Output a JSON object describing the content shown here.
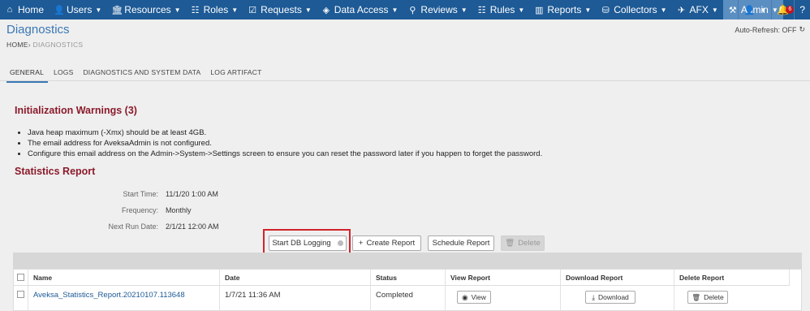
{
  "nav": {
    "items": [
      {
        "label": "Home",
        "icon": "home-icon",
        "glyph": "⌂",
        "caret": false
      },
      {
        "label": "Users",
        "icon": "users-icon",
        "glyph": "👤",
        "caret": true
      },
      {
        "label": "Resources",
        "icon": "building-icon",
        "glyph": "🏛",
        "caret": true
      },
      {
        "label": "Roles",
        "icon": "roles-icon",
        "glyph": "☷",
        "caret": true
      },
      {
        "label": "Requests",
        "icon": "checkbox-icon",
        "glyph": "☑",
        "caret": true
      },
      {
        "label": "Data Access",
        "icon": "database-icon",
        "glyph": "◈",
        "caret": true
      },
      {
        "label": "Reviews",
        "icon": "pin-icon",
        "glyph": "⚲",
        "caret": true
      },
      {
        "label": "Rules",
        "icon": "rules-icon",
        "glyph": "☷",
        "caret": true
      },
      {
        "label": "Reports",
        "icon": "chart-icon",
        "glyph": "▥",
        "caret": true
      },
      {
        "label": "Collectors",
        "icon": "collector-icon",
        "glyph": "⛁",
        "caret": true
      },
      {
        "label": "AFX",
        "icon": "rocket-icon",
        "glyph": "✈",
        "caret": true
      },
      {
        "label": "Admin",
        "icon": "wrench-icon",
        "glyph": "⚒",
        "caret": true
      }
    ],
    "notification_count": "6"
  },
  "header": {
    "title": "Diagnostics",
    "breadcrumb_home": "HOME",
    "breadcrumb_sep": "›",
    "breadcrumb_current": "DIAGNOSTICS",
    "auto_refresh": "Auto-Refresh: OFF"
  },
  "tabs": [
    "GENERAL",
    "LOGS",
    "DIAGNOSTICS AND SYSTEM DATA",
    "LOG ARTIFACT"
  ],
  "warnings": {
    "title": "Initialization Warnings (3)",
    "items": [
      "Java heap maximum (-Xmx) should be at least 4GB.",
      "The email address for AveksaAdmin is not configured.",
      "Configure this email address on the Admin->System->Settings screen to ensure you can reset the password later if you happen to forget the password."
    ]
  },
  "stats": {
    "title": "Statistics Report",
    "start_time_label": "Start Time:",
    "start_time": "11/1/20 1:00 AM",
    "frequency_label": "Frequency:",
    "frequency": "Monthly",
    "next_run_label": "Next Run Date:",
    "next_run": "2/1/21 12:00 AM"
  },
  "buttons": {
    "start_db_logging": "Start DB Logging",
    "create_report": "Create Report",
    "schedule_report": "Schedule Report",
    "delete": "Delete"
  },
  "table": {
    "headers": [
      "Name",
      "Date",
      "Status",
      "View Report",
      "Download Report",
      "Delete Report"
    ],
    "rows": [
      {
        "name": "Aveksa_Statistics_Report.20210107.113648",
        "date": "1/7/21 11:36 AM",
        "status": "Completed",
        "view": "View",
        "download": "Download",
        "delete": "Delete"
      }
    ]
  }
}
